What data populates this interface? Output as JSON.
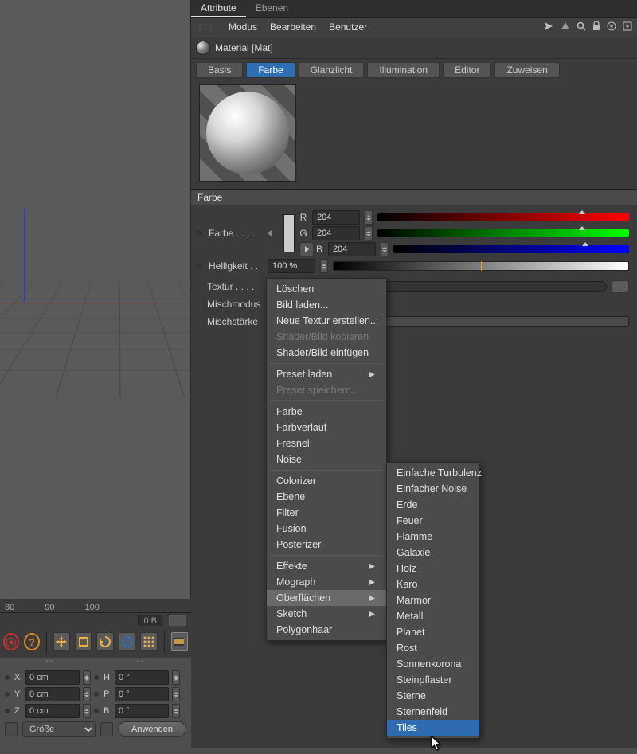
{
  "tabs": {
    "attribute": "Attribute",
    "ebenen": "Ebenen"
  },
  "menubar": {
    "modus": "Modus",
    "bearbeiten": "Bearbeiten",
    "benutzer": "Benutzer"
  },
  "material": {
    "title": "Material [Mat]"
  },
  "channel_tabs": {
    "basis": "Basis",
    "farbe": "Farbe",
    "glanzlicht": "Glanzlicht",
    "illumination": "Illumination",
    "editor": "Editor",
    "zuweisen": "Zuweisen"
  },
  "section": {
    "farbe": "Farbe"
  },
  "props": {
    "farbe_label": "Farbe . . . .",
    "r_label": "R",
    "g_label": "G",
    "b_label": "B",
    "r_val": "204",
    "g_val": "204",
    "b_val": "204",
    "helligkeit_label": "Helligkeit . .",
    "helligkeit_val": "100 %",
    "textur_label": "Textur . . . .",
    "misch_modus_label": "Mischmodus",
    "misch_staerke_label": "Mischstärke",
    "tex_btn": "..."
  },
  "ctx": {
    "groups": [
      [
        "Löschen",
        "Bild laden...",
        "Neue Textur erstellen...",
        "Shader/Bild kopieren",
        "Shader/Bild einfügen"
      ],
      [
        "Preset laden",
        "Preset speichern..."
      ],
      [
        "Farbe",
        "Farbverlauf",
        "Fresnel",
        "Noise"
      ],
      [
        "Colorizer",
        "Ebene",
        "Filter",
        "Fusion",
        "Posterizer"
      ],
      [
        "Effekte",
        "Mograph",
        "Oberflächen",
        "Sketch",
        "Polygonhaar"
      ]
    ],
    "disabled": [
      "Shader/Bild kopieren",
      "Preset speichern..."
    ],
    "has_chevron": [
      "Preset laden",
      "Effekte",
      "Mograph",
      "Oberflächen",
      "Sketch"
    ],
    "selected": "Oberflächen"
  },
  "submenu": {
    "items": [
      "Einfache Turbulenz",
      "Einfacher Noise",
      "Erde",
      "Feuer",
      "Flamme",
      "Galaxie",
      "Holz",
      "Karo",
      "Marmor",
      "Metall",
      "Planet",
      "Rost",
      "Sonnenkorona",
      "Steinpflaster",
      "Sterne",
      "Sternenfeld",
      "Tiles"
    ],
    "highlighted": "Tiles"
  },
  "timeline": {
    "t80": "80",
    "t90": "90",
    "t100": "100",
    "frame": "0 B"
  },
  "coords": {
    "x_label": "X",
    "y_label": "Y",
    "z_label": "Z",
    "h_label": "H",
    "p_label": "P",
    "b_label": "B",
    "x": "0 cm",
    "y": "0 cm",
    "z": "0 cm",
    "h": "0 °",
    "p": "0 °",
    "b": "0 °",
    "size_label": "Größe",
    "apply": "Anwenden",
    "dash": "--"
  }
}
